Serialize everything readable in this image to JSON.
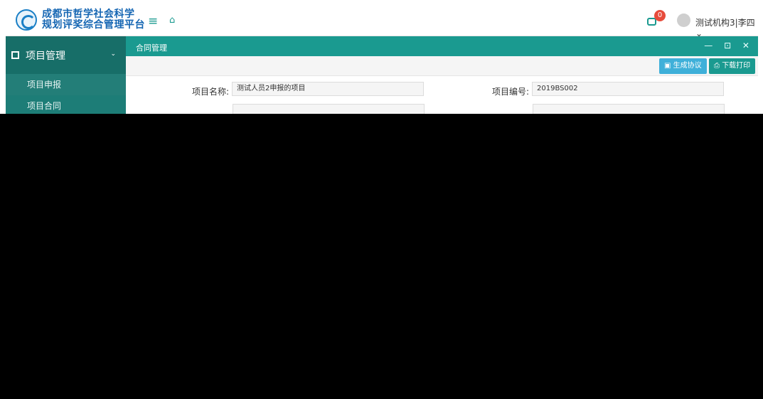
{
  "header": {
    "logo_line1": "成都市哲学社会科学",
    "logo_line2": "规划评奖综合管理平台",
    "hamburger_icon": "menu-icon",
    "home_icon": "home-icon",
    "message_badge": "0",
    "user_name": "测试机构3|李四 ⌄"
  },
  "sidebar": {
    "section_label": "项目管理",
    "items": [
      {
        "label": "项目申报"
      },
      {
        "label": "项目合同"
      }
    ]
  },
  "panel": {
    "title": "合同管理",
    "controls": "— ⊡ ✕"
  },
  "toolbar": {
    "generate_label": "生成协议",
    "print_label": "下载打印"
  },
  "form": {
    "project_name_label": "项目名称:",
    "project_name_value": "测试人员2申报的项目",
    "project_no_label": "项目编号:",
    "project_no_value": "2019BS002"
  },
  "colors": {
    "accent": "#1a9a90",
    "sidebar": "#1d7d77",
    "badge": "#e74c3c"
  }
}
